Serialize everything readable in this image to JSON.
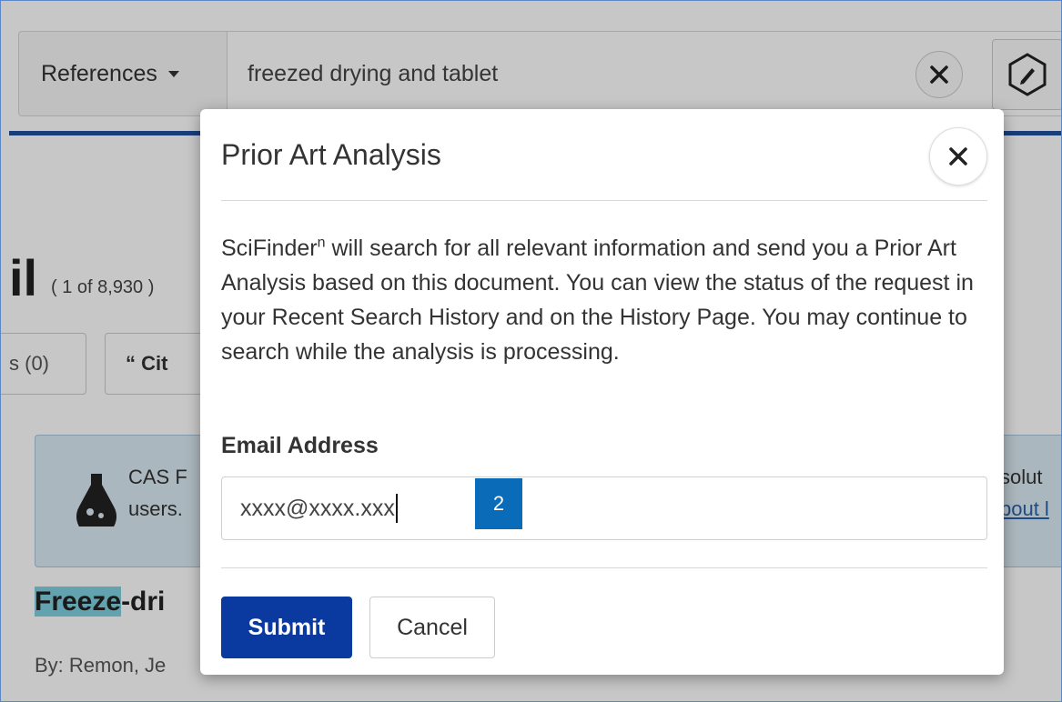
{
  "search": {
    "type_label": "References",
    "query": "freezed drying and tablet",
    "clear_icon": "close-icon",
    "draw_icon": "pencil-icon"
  },
  "background": {
    "title_fragment": "il",
    "count": "( 1 of 8,930 )",
    "pill_left": "s (0)",
    "pill_cite": "“ Cit",
    "notice_line1": "CAS F",
    "notice_line2": "users.",
    "notice_right1": "solut",
    "notice_right2": "bout l",
    "result_title_hl": "Freeze",
    "result_title_rest": "-dri",
    "result_by": "By: Remon, Je"
  },
  "modal": {
    "title": "Prior Art Analysis",
    "description_prefix": "SciFinder",
    "description_sup": "n",
    "description": " will search for all relevant information and send you a Prior Art Analysis based on this document. You can view the status of the request in your Recent Search History and on the History Page. You may continue to search while the analysis is processing.",
    "email_label": "Email Address",
    "email_value": "xxxx@xxxx.xxx",
    "badge": "2",
    "submit_label": "Submit",
    "cancel_label": "Cancel"
  },
  "colors": {
    "primary": "#0a3aa0",
    "badge": "#0a6cb8",
    "rule": "#1f4f9c"
  }
}
